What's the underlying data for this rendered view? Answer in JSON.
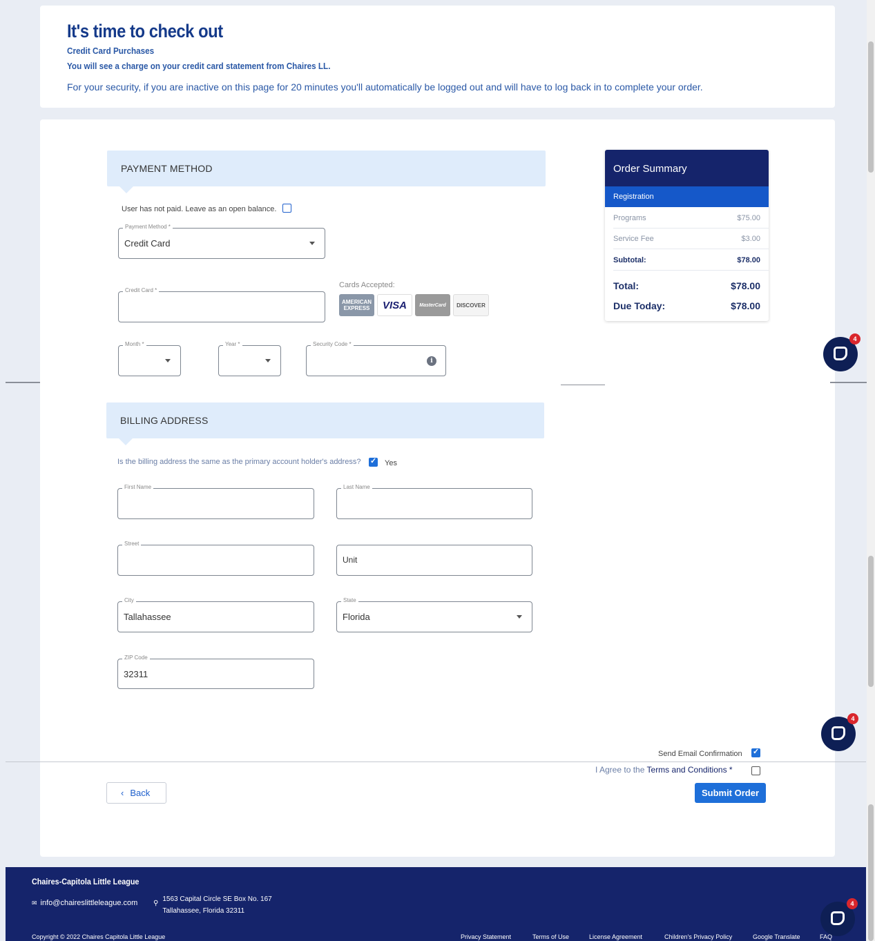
{
  "header": {
    "title": "It's time to check out",
    "subtitle1": "Credit Card Purchases",
    "subtitle2": "You will see a charge on your credit card statement from Chaires LL.",
    "notice": "For your security, if you are inactive on this page for 20 minutes you'll automatically be logged out and will have to log back in to complete your order."
  },
  "payment": {
    "section_title": "PAYMENT METHOD",
    "open_balance_label": "User has not paid. Leave as an open balance.",
    "open_balance_checked": false,
    "method_label": "Payment Method *",
    "method_value": "Credit Card",
    "card_label": "Credit Card *",
    "card_value": "",
    "cards_accepted_label": "Cards Accepted:",
    "cards": [
      {
        "name": "amex-logo",
        "text": "AMERICAN EXPRESS",
        "color": "#8a97a8"
      },
      {
        "name": "visa-logo",
        "text": "VISA",
        "color": "#1a1f71"
      },
      {
        "name": "mastercard-logo",
        "text": "MasterCard",
        "color": "#9a9a9a"
      },
      {
        "name": "discover-logo",
        "text": "DISCOVER",
        "color": "#555555"
      }
    ],
    "month_label": "Month *",
    "year_label": "Year *",
    "security_label": "Security Code *"
  },
  "billing": {
    "section_title": "BILLING ADDRESS",
    "same_address_question": "Is the billing address the same as the primary account holder's address?",
    "same_address_answer": "Yes",
    "same_address_checked": true,
    "first_name_label": "First Name",
    "last_name_label": "Last Name",
    "street_label": "Street",
    "unit_placeholder": "Unit",
    "city_label": "City",
    "city_value": "Tallahassee",
    "state_label": "State",
    "state_value": "Florida",
    "zip_label": "ZIP Code",
    "zip_value": "32311"
  },
  "summary": {
    "title": "Order Summary",
    "category": "Registration",
    "programs_label": "Programs",
    "programs_value": "$75.00",
    "fee_label": "Service Fee",
    "fee_value": "$3.00",
    "subtotal_label": "Subtotal:",
    "subtotal_value": "$78.00",
    "total_label": "Total:",
    "total_value": "$78.00",
    "due_label": "Due Today:",
    "due_value": "$78.00"
  },
  "actions": {
    "send_email_label": "Send Email Confirmation",
    "send_email_checked": true,
    "agree_prefix": "I Agree to the ",
    "agree_link": "Terms and Conditions",
    "agree_suffix": " *",
    "back_label": "Back",
    "submit_label": "Submit Order"
  },
  "chat_badge_count": "4",
  "footer": {
    "org": "Chaires-Capitola Little League",
    "email": "info@chaireslittleleague.com",
    "address_line1": "1563 Capital Circle SE Box No. 167",
    "address_line2": "Tallahassee, Florida 32311",
    "copyright": "Copyright © 2022 Chaires Capitola Little League",
    "links": [
      "Privacy Statement",
      "Terms of Use",
      "License Agreement",
      "Children's Privacy Policy",
      "Google Translate",
      "FAQ"
    ]
  },
  "colors": {
    "brand_navy": "#15246b",
    "accent_blue": "#1e6fd9",
    "heading_blue": "#153a8a",
    "section_bg": "#dfecfb"
  }
}
